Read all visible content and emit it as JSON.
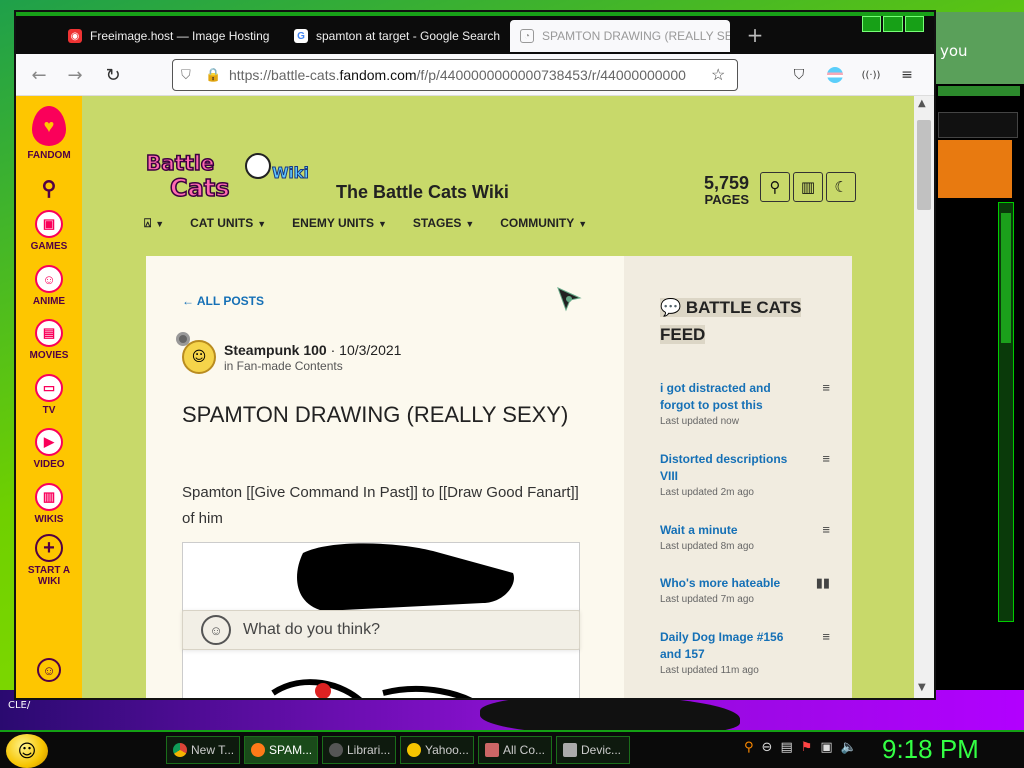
{
  "browser": {
    "tabs": [
      {
        "title": "Freeimage.host — Image Hosting",
        "close": "×"
      },
      {
        "title": "spamton at target - Google Search",
        "close": "×"
      },
      {
        "title": "SPAMTON DRAWING (REALLY SEXY)",
        "close": "×"
      }
    ],
    "new_tab": "+",
    "url": "https://battle-cats.fandom.com/f/p/4400000000000738453/r/44000000000",
    "url_host_bold": "fandom.com"
  },
  "rail": {
    "brand": "FANDOM",
    "items": [
      {
        "label": "GAMES"
      },
      {
        "label": "ANIME"
      },
      {
        "label": "MOVIES"
      },
      {
        "label": "TV"
      },
      {
        "label": "VIDEO"
      },
      {
        "label": "WIKIS"
      },
      {
        "label": "START A WIKI"
      }
    ]
  },
  "wiki": {
    "logo_text": "The Battle Cats Wiki",
    "title": "The Battle Cats Wiki",
    "page_count": "5,759",
    "page_label": "PAGES",
    "nav": [
      "CAT UNITS",
      "ENEMY UNITS",
      "STAGES",
      "COMMUNITY"
    ]
  },
  "post": {
    "back_label": "ALL POSTS",
    "author": "Steampunk 100",
    "date": "10/3/2021",
    "category": "in Fan-made Contents",
    "title": "SPAMTON DRAWING (REALLY SEXY)",
    "body": "Spamton [[Give Command In Past]] to [[Draw Good Fanart]] of him",
    "reply_placeholder": "What do you think?"
  },
  "feed": {
    "title": "BATTLE CATS FEED",
    "items": [
      {
        "title": "i got distracted and forgot to post this",
        "time": "Last updated now",
        "icon": "text-lines-icon"
      },
      {
        "title": "Distorted descriptions VIII",
        "time": "Last updated 2m ago",
        "icon": "text-lines-icon"
      },
      {
        "title": "Wait a minute",
        "time": "Last updated 8m ago",
        "icon": "text-lines-icon"
      },
      {
        "title": "Who's more hateable",
        "time": "Last updated 7m ago",
        "icon": "poll-icon"
      },
      {
        "title": "Daily Dog Image #156 and 157",
        "time": "Last updated 11m ago",
        "icon": "text-lines-icon"
      }
    ]
  },
  "side_window": {
    "text": "you"
  },
  "taskbar": {
    "tasks": [
      "New T...",
      "SPAM...",
      "Librari...",
      "Yahoo...",
      "All Co...",
      "Devic..."
    ],
    "clock": "9:18 PM"
  },
  "desktop": {
    "label": "CLE/"
  }
}
